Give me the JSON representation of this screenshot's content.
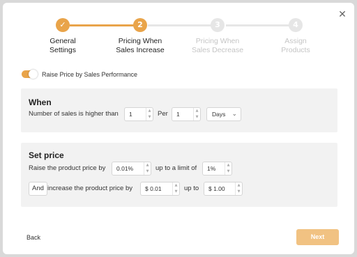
{
  "dialog": {
    "close_icon": "close-icon"
  },
  "steps": [
    {
      "number": "",
      "icon": "check-icon",
      "label_line1": "General",
      "label_line2": "Settings",
      "state": "completed"
    },
    {
      "number": "2",
      "label_line1": "Pricing When",
      "label_line2": "Sales Increase",
      "state": "current"
    },
    {
      "number": "3",
      "label_line1": "Pricing When",
      "label_line2": "Sales Decrease",
      "state": "upcoming"
    },
    {
      "number": "4",
      "label_line1": "Assign",
      "label_line2": "Products",
      "state": "upcoming"
    }
  ],
  "toggle": {
    "label": "Raise Price by Sales Performance",
    "on": true
  },
  "when": {
    "title": "When",
    "sales_label": "Number of sales is higher than",
    "sales_value": "1",
    "per_label": "Per",
    "per_value": "1",
    "period": "Days"
  },
  "set_price": {
    "title": "Set price",
    "raise_label": "Raise the product price by",
    "raise_value": "0.01%",
    "limit_label": "up to a limit of",
    "limit_value": "1%",
    "and_label": "And",
    "increase_label": "increase the product price by",
    "increase_value": "$ 0.01",
    "up_to_label": "up to",
    "up_to_value": "$ 1.00"
  },
  "footer": {
    "back_label": "Back",
    "next_label": "Next"
  },
  "colors": {
    "accent": "#e9a44a",
    "next_button": "#f1c282",
    "panel": "#f2f2f2"
  }
}
